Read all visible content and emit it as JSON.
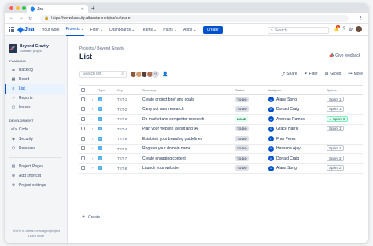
{
  "browser": {
    "tab_title": "Jira",
    "new_tab": "+",
    "url": "https://www.bancity.atlassian.net/jira/software",
    "dot_colors": [
      "#ff5f57",
      "#febc2e",
      "#28c840"
    ]
  },
  "topnav": {
    "logo": "Jira",
    "items": [
      {
        "label": "Your work",
        "active": false
      },
      {
        "label": "Projects",
        "active": true
      },
      {
        "label": "Filter",
        "active": false
      },
      {
        "label": "Dashboards",
        "active": false
      },
      {
        "label": "Teams",
        "active": false
      },
      {
        "label": "Plans",
        "active": false
      },
      {
        "label": "Apps",
        "active": false
      }
    ],
    "create_label": "Create",
    "search_placeholder": "Search",
    "notification_count": "9+"
  },
  "sidebar": {
    "project_name": "Beyond Gravity",
    "project_type": "Software project",
    "planning_title": "Planning",
    "planning_items": [
      {
        "label": "Backlog",
        "icon": "backlog-icon",
        "glyph": "☰",
        "active": false
      },
      {
        "label": "Board",
        "icon": "board-icon",
        "glyph": "▦",
        "active": false
      },
      {
        "label": "List",
        "icon": "list-icon",
        "glyph": "≡",
        "active": true
      },
      {
        "label": "Reports",
        "icon": "reports-icon",
        "glyph": "↗",
        "active": false
      },
      {
        "label": "Issues",
        "icon": "issues-icon",
        "glyph": "▢",
        "active": false
      }
    ],
    "development_title": "Development",
    "development_items": [
      {
        "label": "Code",
        "icon": "code-icon",
        "glyph": "</>"
      },
      {
        "label": "Security",
        "icon": "security-icon",
        "glyph": "◈"
      },
      {
        "label": "Releases",
        "icon": "releases-icon",
        "glyph": "⬡"
      }
    ],
    "extra_items": [
      {
        "label": "Project Pages",
        "icon": "pages-icon",
        "glyph": "▤"
      },
      {
        "label": "Add shortcut",
        "icon": "shortcut-icon",
        "glyph": "⊕"
      },
      {
        "label": "Project settings",
        "icon": "settings-icon",
        "glyph": "⚙"
      }
    ],
    "footer_line1": "You're in a team-managed project",
    "footer_link": "Learn more"
  },
  "main": {
    "breadcrumb": "Projects / Beyond Gravity",
    "title": "List",
    "feedback_label": "Give feedback",
    "search_placeholder": "Search list",
    "avatar_colors": [
      "#8b5a3c",
      "#d39b6a",
      "#5a3e36",
      "#b07156"
    ],
    "avatar_more": "+3",
    "toolbar": {
      "share": "Share",
      "filter": "Filter",
      "group": "Group",
      "more": "More"
    },
    "columns": [
      "Type",
      "Key",
      "Summary",
      "Status",
      "Assignee",
      "Sprints"
    ],
    "rows": [
      {
        "key": "TST-1",
        "summary": "Create project brief and goals",
        "status": "TO DO",
        "assignee": "Alana Song",
        "sprint": "Sprint 1",
        "done": false
      },
      {
        "key": "TST-2",
        "summary": "Carry out user research",
        "status": "TO DO",
        "assignee": "Donald Craig",
        "sprint": "Sprint 1",
        "done": false
      },
      {
        "key": "TST-3",
        "summary": "Do market and competitor research",
        "status": "DONE",
        "assignee": "Andreas Ramos",
        "sprint": "Sprint 0",
        "done": true
      },
      {
        "key": "TST-4",
        "summary": "Plan your website layout and IA",
        "status": "TO DO",
        "assignee": "Grace Harris",
        "sprint": "Sprint 1",
        "done": false
      },
      {
        "key": "TST-5",
        "summary": "Establish your branding guidelines",
        "status": "TO DO",
        "assignee": "Fran Perez",
        "sprint": "",
        "done": false
      },
      {
        "key": "TST-6",
        "summary": "Register your domain name",
        "status": "TO DO",
        "assignee": "Hassana Ajayi",
        "sprint": "Sprint 1",
        "done": false
      },
      {
        "key": "TST-7",
        "summary": "Create engaging content",
        "status": "TO DO",
        "assignee": "Donald Craig",
        "sprint": "Sprint 2",
        "done": false
      },
      {
        "key": "TST-8",
        "summary": "Launch your website",
        "status": "TO DO",
        "assignee": "Alana Song",
        "sprint": "Sprint 2",
        "done": false
      }
    ],
    "create_label": "Create"
  }
}
